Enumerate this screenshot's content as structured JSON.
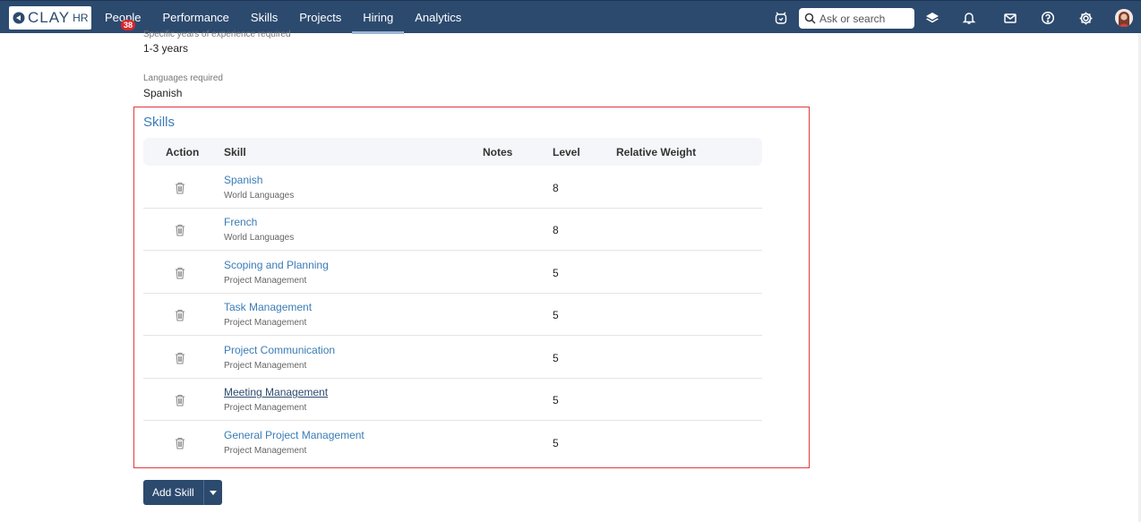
{
  "header": {
    "logo_text": "CLAY",
    "logo_suffix": "HR",
    "nav": [
      {
        "label": "People",
        "badge": "38"
      },
      {
        "label": "Performance"
      },
      {
        "label": "Skills"
      },
      {
        "label": "Projects"
      },
      {
        "label": "Hiring",
        "active": true
      },
      {
        "label": "Analytics"
      }
    ],
    "search_placeholder": "Ask or search",
    "icons": [
      "clock-chat-icon",
      "search-icon",
      "layers-icon",
      "bell-icon",
      "mail-icon",
      "help-icon",
      "gear-icon",
      "avatar"
    ]
  },
  "fields": {
    "experience_label": "Specific years of experience required",
    "experience_value": "1-3 years",
    "languages_label": "Languages required",
    "languages_value": "Spanish"
  },
  "skills": {
    "title": "Skills",
    "columns": {
      "action": "Action",
      "skill": "Skill",
      "notes": "Notes",
      "level": "Level",
      "weight": "Relative Weight"
    },
    "rows": [
      {
        "name": "Spanish",
        "category": "World Languages",
        "level": "8"
      },
      {
        "name": "French",
        "category": "World Languages",
        "level": "8"
      },
      {
        "name": "Scoping and Planning",
        "category": "Project Management",
        "level": "5"
      },
      {
        "name": "Task Management",
        "category": "Project Management",
        "level": "5"
      },
      {
        "name": "Project Communication",
        "category": "Project Management",
        "level": "5"
      },
      {
        "name": "Meeting Management",
        "category": "Project Management",
        "level": "5"
      },
      {
        "name": "General Project Management",
        "category": "Project Management",
        "level": "5"
      }
    ]
  },
  "actions": {
    "add_skill": "Add Skill"
  },
  "colors": {
    "nav_bg": "#2c4a6e",
    "link": "#3a7cb6",
    "highlight_border": "#e0393e",
    "badge": "#d9262c"
  }
}
